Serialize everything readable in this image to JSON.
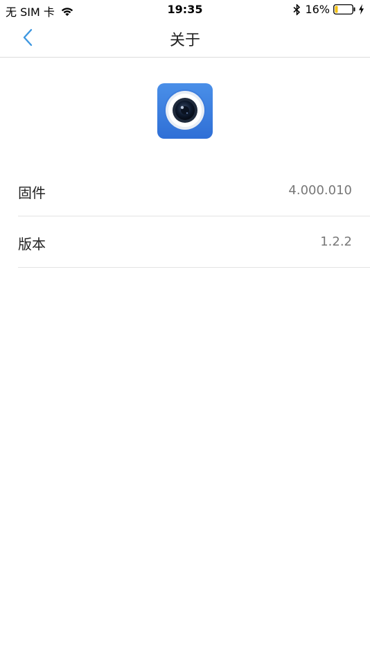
{
  "status_bar": {
    "carrier": "无 SIM 卡",
    "time": "19:35",
    "battery_percent": "16%",
    "battery_level": 0.16,
    "icons": [
      "wifi-icon",
      "bluetooth-icon",
      "battery-icon",
      "charging-bolt-icon"
    ]
  },
  "nav": {
    "title": "关于",
    "back_icon": "chevron-left-icon"
  },
  "app": {
    "icon": "camera-lens-app-icon"
  },
  "info": [
    {
      "label": "固件",
      "value": "4.000.010"
    },
    {
      "label": "版本",
      "value": "1.2.2"
    }
  ],
  "colors": {
    "accent": "#3d97e0",
    "icon_blue": "#3f7fe0",
    "battery_fill": "#f5c211"
  }
}
